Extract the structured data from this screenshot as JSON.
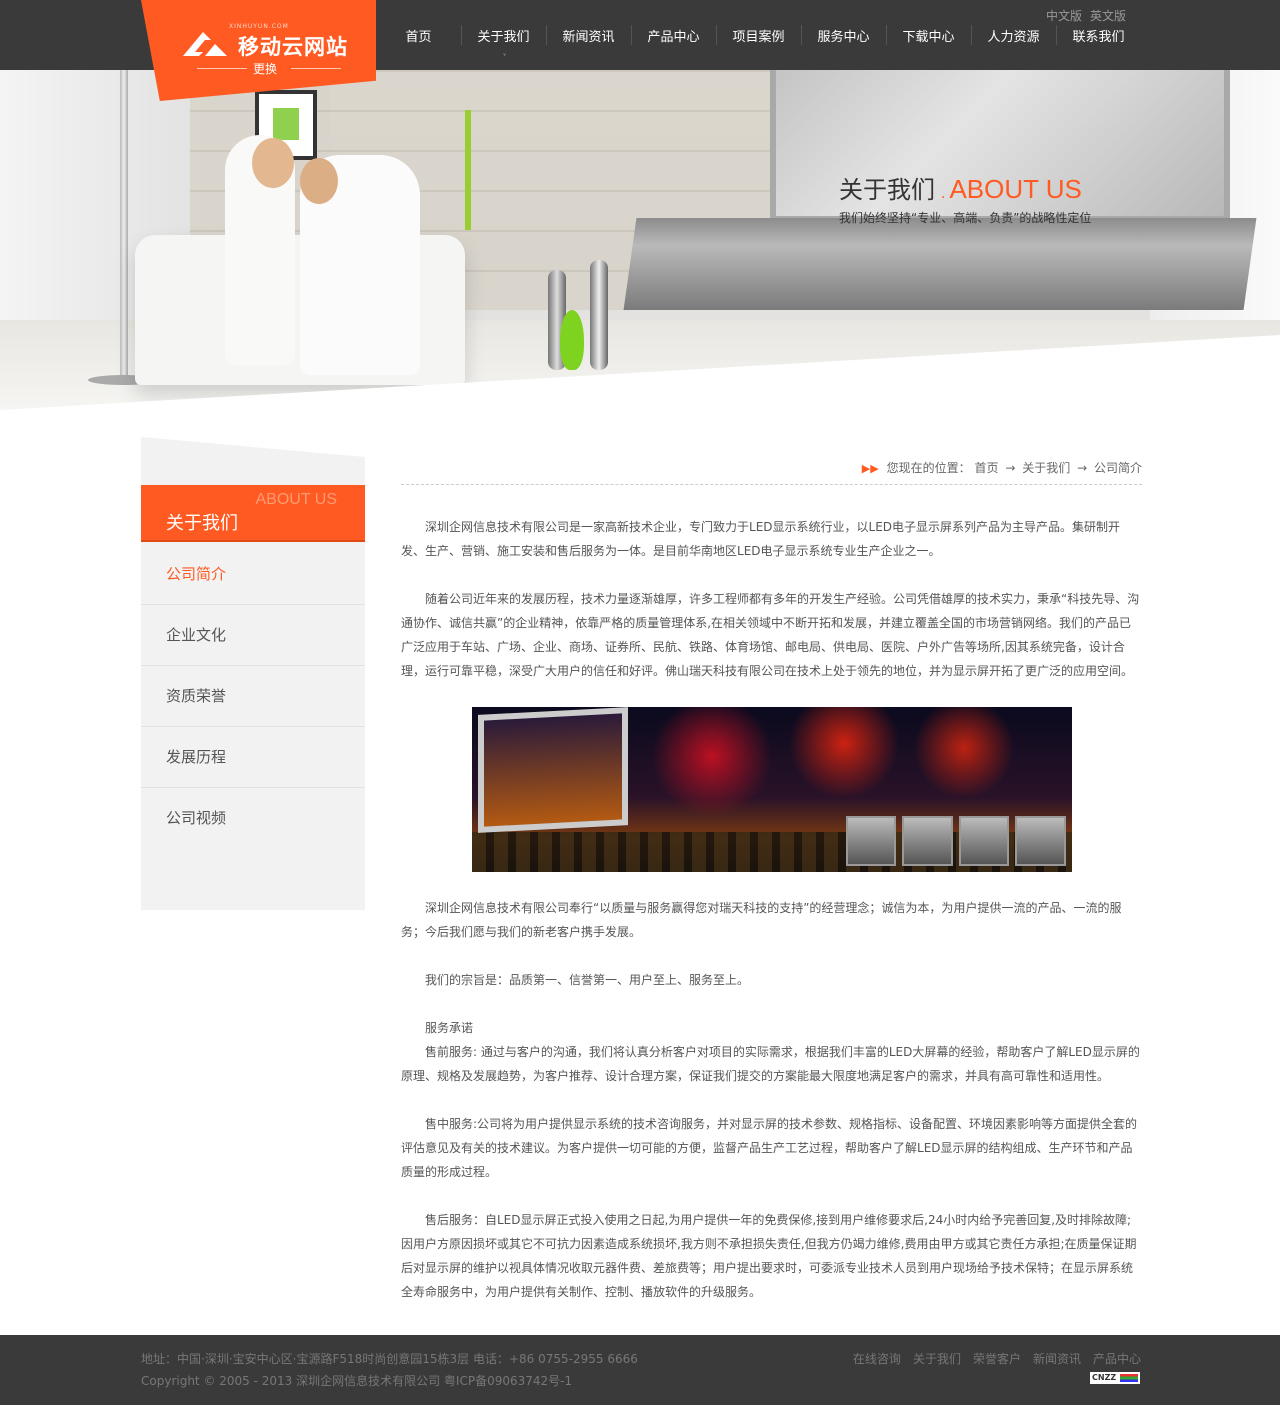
{
  "header": {
    "logo_small": "XINHUYUN.COM",
    "logo_text": "移动云网站",
    "logo_change": "更换",
    "lang": [
      "中文版",
      "英文版"
    ],
    "nav": [
      "首页",
      "关于我们",
      "新闻资讯",
      "产品中心",
      "项目案例",
      "服务中心",
      "下载中心",
      "人力资源",
      "联系我们"
    ],
    "active_nav_caret": "˅"
  },
  "banner": {
    "title_cn": "关于我们",
    "title_dot": ".",
    "title_en": "ABOUT US",
    "subtitle": "我们始终坚持“专业、高端、负责”的战略性定位"
  },
  "sidebar": {
    "head_en": "ABOUT US",
    "head_cn": "关于我们",
    "items": [
      "公司简介",
      "企业文化",
      "资质荣誉",
      "发展历程",
      "公司视频"
    ],
    "active_index": 0
  },
  "breadcrumb": {
    "prefix": "您现在的位置：",
    "items": [
      "首页",
      "关于我们",
      "公司简介"
    ],
    "separator": "→"
  },
  "content": {
    "p1": "深圳企网信息技术有限公司是一家高新技术企业，专门致力于LED显示系统行业，以LED电子显示屏系列产品为主导产品。集研制开发、生产、营销、施工安装和售后服务为一体。是目前华南地区LED电子显示系统专业生产企业之一。",
    "p2": "随着公司近年来的发展历程，技术力量逐渐雄厚，许多工程师都有多年的开发生产经验。公司凭借雄厚的技术实力，秉承“科技先导、沟通协作、诚信共赢”的企业精神，依靠严格的质量管理体系,在相关领域中不断开拓和发展，并建立覆盖全国的市场营销网络。我们的产品已广泛应用于车站、广场、企业、商场、证券所、民航、铁路、体育场馆、邮电局、供电局、医院、户外广告等场所,因其系统完备，设计合理，运行可靠平稳，深受广大用户的信任和好评。佛山瑞天科技有限公司在技术上处于领先的地位，并为显示屏开拓了更广泛的应用空间。",
    "p3": "深圳企网信息技术有限公司奉行“以质量与服务赢得您对瑞天科技的支持”的经营理念；诚信为本，为用户提供一流的产品、一流的服务；今后我们愿与我们的新老客户携手发展。",
    "p4": "我们的宗旨是：品质第一、信誉第一、用户至上、服务至上。",
    "p5_title": "服务承诺",
    "p5": "售前服务: 通过与客户的沟通，我们将认真分析客户对项目的实际需求，根据我们丰富的LED大屏幕的经验，帮助客户了解LED显示屏的原理、规格及发展趋势，为客户推荐、设计合理方案，保证我们提交的方案能最大限度地满足客户的需求，并具有高可靠性和适用性。",
    "p6": "售中服务:公司将为用户提供显示系统的技术咨询服务，并对显示屏的技术参数、规格指标、设备配置、环境因素影响等方面提供全套的评估意见及有关的技术建议。为客户提供一切可能的方便，监督产品生产工艺过程，帮助客户了解LED显示屏的结构组成、生产环节和产品质量的形成过程。",
    "p7": "售后服务：自LED显示屏正式投入使用之日起,为用户提供一年的免费保修,接到用户维修要求后,24小时内给予完善回复,及时排除故障;因用户方原因损坏或其它不可抗力因素造成系统损坏,我方则不承担损失责任,但我方仍竭力维修,费用由甲方或其它责任方承担;在质量保证期后对显示屏的维护以视具体情况收取元器件费、差旅费等；用户提出要求时，可委派专业技术人员到用户现场给予技术保特；在显示屏系统全寿命服务中，为用户提供有关制作、控制、播放软件的升级服务。"
  },
  "footer": {
    "address": "地址：中国·深圳·宝安中心区·宝源路F518时尚创意园15栋3层 电话：+86 0755-2955 6666",
    "copyright": "Copyright © 2005 - 2013 深圳企网信息技术有限公司 粤ICP备09063742号-1",
    "links": [
      "在线咨询",
      "关于我们",
      "荣誉客户",
      "新闻资讯",
      "产品中心"
    ],
    "badge": "CNZZ"
  },
  "colors": {
    "accent": "#ff5a22",
    "dark_bar": "#3a3a3a",
    "sidebar_bg": "#f2f2f2"
  }
}
